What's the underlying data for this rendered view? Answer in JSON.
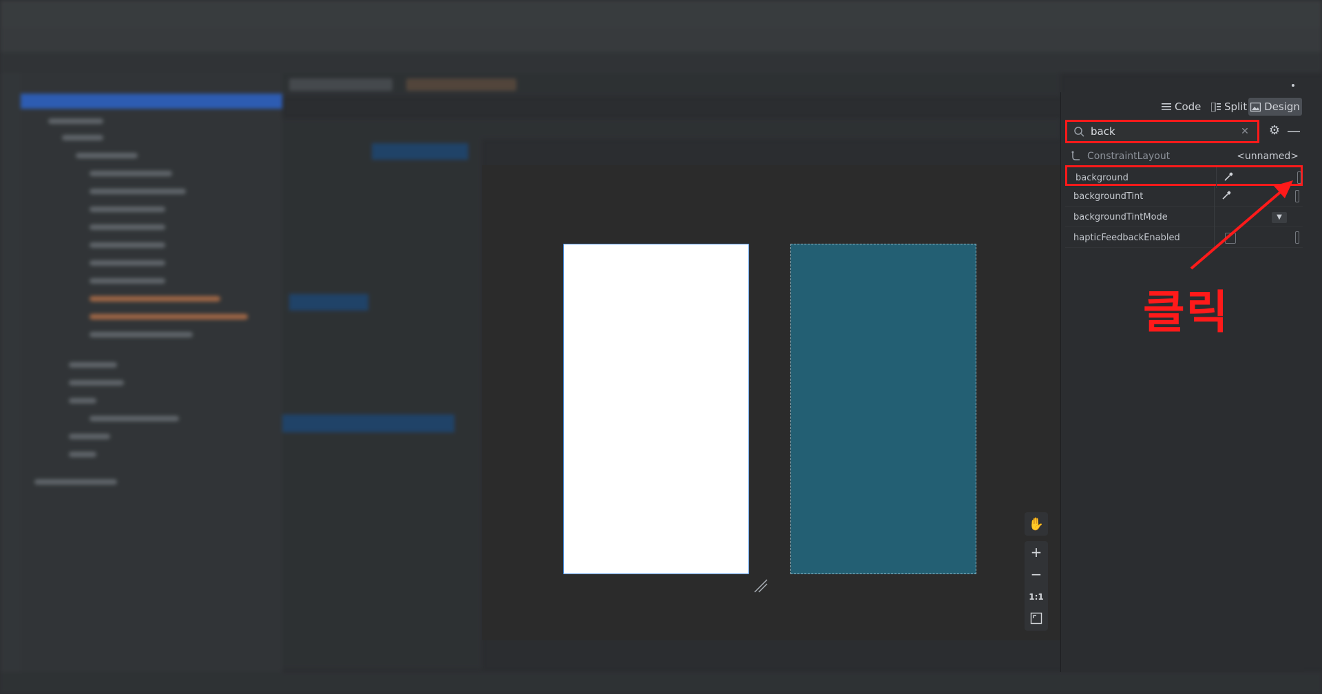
{
  "view_toggle": {
    "code_label": "Code",
    "split_label": "Split",
    "design_label": "Design",
    "active": "Design"
  },
  "search": {
    "value": "back",
    "clear_icon": "close-icon"
  },
  "component": {
    "type": "ConstraintLayout",
    "id": "<unnamed>"
  },
  "attributes": [
    {
      "name": "background",
      "control": "color-picker"
    },
    {
      "name": "backgroundTint",
      "control": "color-picker"
    },
    {
      "name": "backgroundTintMode",
      "control": "dropdown"
    },
    {
      "name": "hapticFeedbackEnabled",
      "control": "checkbox"
    }
  ],
  "annotation": {
    "label": "클릭",
    "color": "#ff1a1a"
  },
  "canvas": {
    "design_color": "#ffffff",
    "blueprint_color": "#235f73"
  },
  "zoom": {
    "actual_size_label": "1:1"
  }
}
